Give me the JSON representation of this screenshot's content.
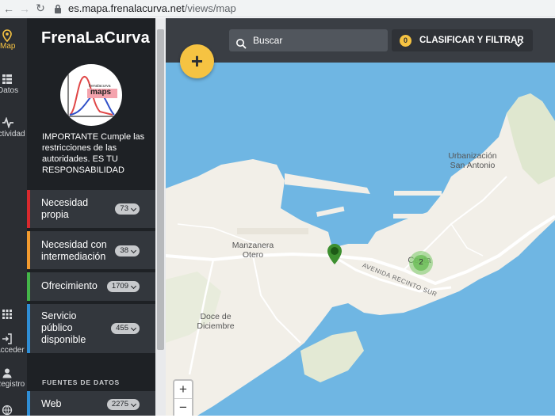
{
  "browser": {
    "url_host": "es.mapa.frenalacurva.net",
    "url_path": "/views/map"
  },
  "rail": {
    "items": [
      {
        "label": "Map",
        "icon": "map-pin-icon"
      },
      {
        "label": "Datos",
        "icon": "list-icon"
      },
      {
        "label": "Actividad",
        "icon": "activity-icon"
      },
      {
        "label": "Acceder",
        "icon": "login-icon"
      },
      {
        "label": "Registro",
        "icon": "user-icon"
      }
    ]
  },
  "sidebar": {
    "brand": "FrenaLaCurva",
    "logo_caption_small": "frenalacurva",
    "logo_caption": "maps",
    "notice": "IMPORTANTE Cumple las restricciones de las autoridades. ES TU RESPONSABILIDAD",
    "categories": [
      {
        "label": "Necesidad propia",
        "count": "73",
        "color": "#d9292e"
      },
      {
        "label": "Necesidad con intermediación",
        "count": "38",
        "color": "#f39b2f"
      },
      {
        "label": "Ofrecimiento",
        "count": "1709",
        "color": "#44b649"
      },
      {
        "label": "Servicio público disponible",
        "count": "455",
        "color": "#2f8ed6"
      }
    ],
    "sources_title": "FUENTES DE DATOS",
    "sources": [
      {
        "label": "Web",
        "count": "2275",
        "color": "#2f8ed6"
      }
    ]
  },
  "topbar": {
    "search_placeholder": "Buscar",
    "filter_count": "0",
    "filter_label": "CLASIFICAR Y FILTRAR"
  },
  "map": {
    "fab_label": "+",
    "zoom_in": "+",
    "zoom_out": "−",
    "labels": {
      "urbanizacion_1": "Urbanización",
      "urbanizacion_2": "San Antonio",
      "manzanera_1": "Manzanera",
      "manzanera_2": "Otero",
      "doce_1": "Doce de",
      "doce_2": "Diciembre",
      "ceuta": "Ceuta",
      "avenida": "AVENIDA RECINTO SUR"
    },
    "cluster_count": "2",
    "colors": {
      "water": "#6fb6e3",
      "land": "#f2efe8",
      "marker": "#3d8f2f",
      "cluster": "#78c864"
    }
  }
}
